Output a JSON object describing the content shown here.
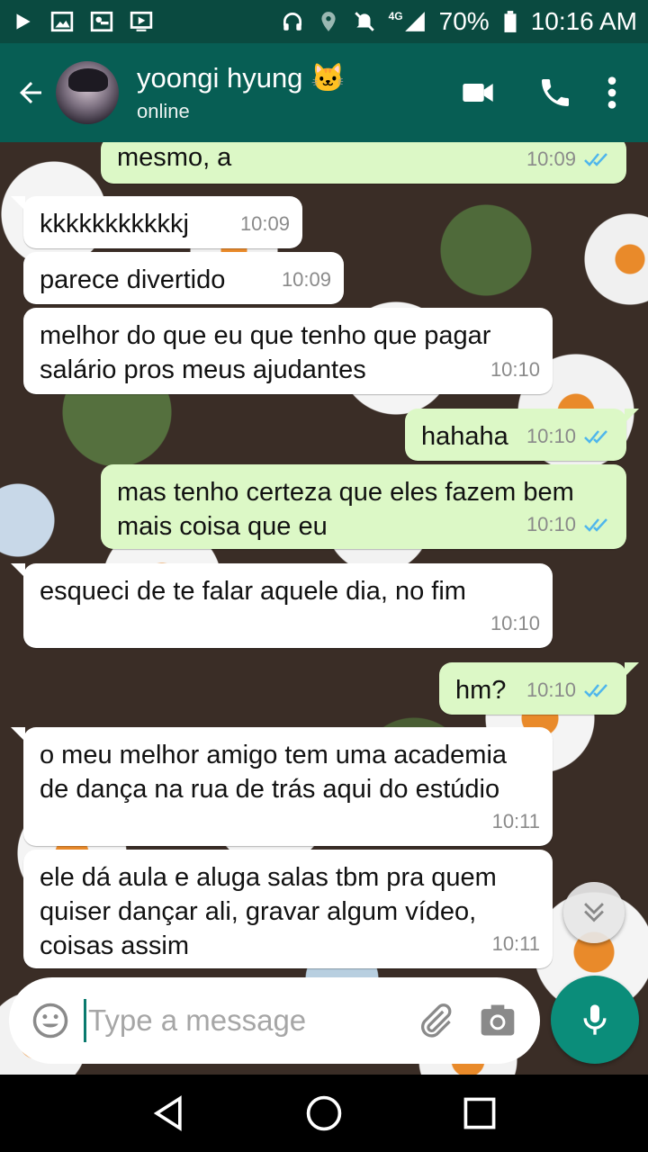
{
  "status_bar": {
    "network": "4G",
    "battery": "70%",
    "time": "10:16 AM"
  },
  "header": {
    "contact_name": "yoongi hyung 🐱",
    "contact_status": "online"
  },
  "messages": [
    {
      "direction": "out",
      "text": "mesmo, a",
      "time": "10:09",
      "read": true
    },
    {
      "direction": "in",
      "text": "kkkkkkkkkkkj",
      "time": "10:09"
    },
    {
      "direction": "in",
      "text": "parece divertido",
      "time": "10:09"
    },
    {
      "direction": "in",
      "text": "melhor do que eu que tenho que pagar salário pros meus ajudantes",
      "time": "10:10"
    },
    {
      "direction": "out",
      "text": "hahaha",
      "time": "10:10",
      "read": true
    },
    {
      "direction": "out",
      "text": "mas tenho certeza que eles fazem bem mais coisa que eu",
      "time": "10:10",
      "read": true
    },
    {
      "direction": "in",
      "text": "esqueci de te falar aquele dia, no fim",
      "time": "10:10"
    },
    {
      "direction": "out",
      "text": "hm?",
      "time": "10:10",
      "read": true
    },
    {
      "direction": "in",
      "text": "o meu melhor amigo tem uma academia de dança na rua de trás aqui do estúdio",
      "time": "10:11"
    },
    {
      "direction": "in",
      "text": "ele dá aula e aluga salas tbm pra quem quiser dançar ali, gravar algum vídeo, coisas assim",
      "time": "10:11"
    }
  ],
  "composer": {
    "placeholder": "Type a message"
  },
  "colors": {
    "header": "#075e54",
    "status_bar": "#0a4a40",
    "outgoing_bubble": "#dcf8c6",
    "incoming_bubble": "#ffffff",
    "read_ticks": "#4fb6ec",
    "mic_button": "#0b8d7a"
  },
  "icons": {
    "status_left": [
      "play-icon",
      "image-icon",
      "vpn-key-icon",
      "cast-icon"
    ],
    "status_right": [
      "headphones-icon",
      "location-icon",
      "mute-icon",
      "signal-icon",
      "battery-icon"
    ],
    "header_actions": [
      "video-call-icon",
      "phone-icon",
      "more-vert-icon"
    ],
    "composer": [
      "emoji-icon",
      "paperclip-icon",
      "camera-icon",
      "mic-icon"
    ],
    "nav": [
      "back-triangle-icon",
      "home-circle-icon",
      "recents-square-icon"
    ]
  }
}
